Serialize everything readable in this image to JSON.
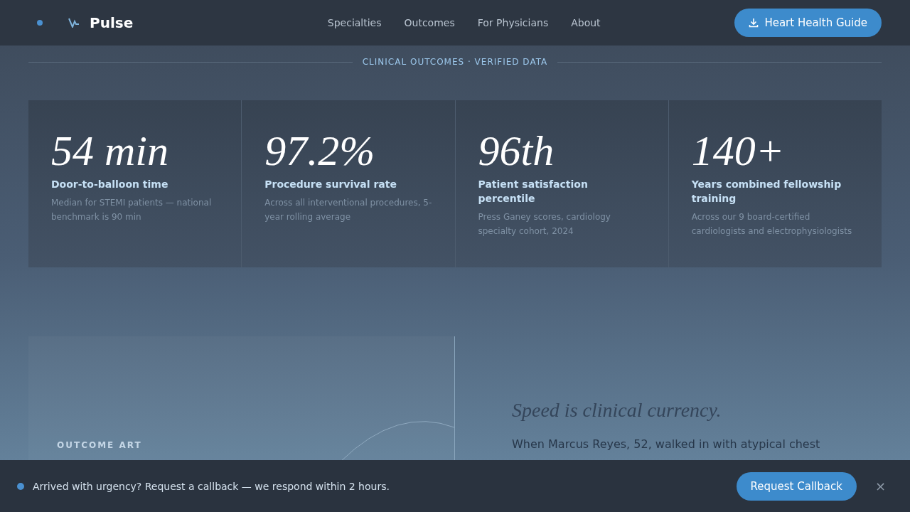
{
  "header": {
    "brand": "Pulse",
    "nav": [
      {
        "label": "Specialties"
      },
      {
        "label": "Outcomes"
      },
      {
        "label": "For Physicians"
      },
      {
        "label": "About"
      }
    ],
    "cta": "Heart Health Guide"
  },
  "section_label": "CLINICAL OUTCOMES · VERIFIED DATA",
  "stats": [
    {
      "value": "54 min",
      "title": "Door-to-balloon time",
      "note": "Median for STEMI patients — national benchmark is 90 min"
    },
    {
      "value": "97.2%",
      "title": "Procedure survival rate",
      "note": "Across all interventional procedures, 5-year rolling average"
    },
    {
      "value": "96th",
      "title": "Patient satisfaction percentile",
      "note": "Press Ganey scores, cardiology specialty cohort, 2024"
    },
    {
      "value": "140+",
      "title": "Years combined fellowship training",
      "note": "Across our 9 board-certified cardiologists and electrophysiologists"
    }
  ],
  "story": {
    "art_label": "OUTCOME ART",
    "heading": "Speed is clinical currency.",
    "body": "When Marcus Reyes, 52, walked in with atypical chest"
  },
  "callback_bar": {
    "message": "Arrived with urgency? Request a callback — we respond within 2 hours.",
    "button": "Request Callback",
    "close": "×"
  }
}
